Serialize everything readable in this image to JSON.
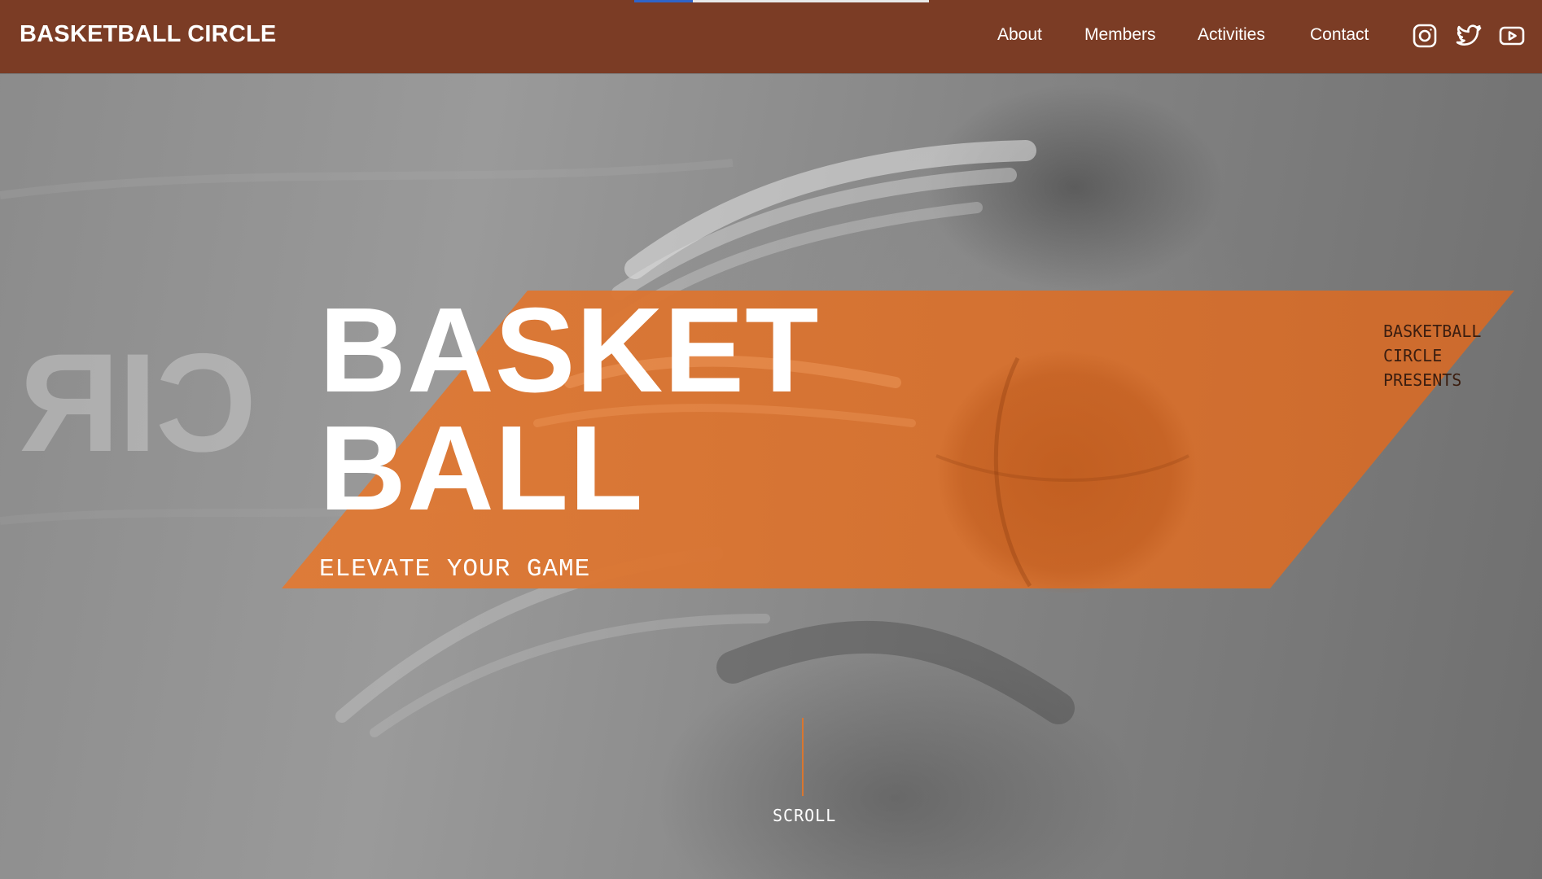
{
  "header": {
    "brand": "BASKETBALL CIRCLE",
    "nav": [
      {
        "label": "About"
      },
      {
        "label": "Members"
      },
      {
        "label": "Activities"
      },
      {
        "label": "Contact"
      }
    ],
    "social_icons": [
      "instagram-icon",
      "twitter-icon",
      "youtube-icon"
    ],
    "progress": 0.2
  },
  "hero": {
    "ghost_text": "CIR",
    "headline_line1": "BASKET",
    "headline_line2": "BALL",
    "tagline": "ELEVATE YOUR GAME",
    "side_note": [
      "BASKETBALL",
      "CIRCLE",
      "PRESENTS"
    ],
    "scroll_label": "SCROLL"
  },
  "colors": {
    "header_bg": "#7b3c25",
    "band_orange": "#d8722f",
    "progress_fill": "#2f64c9",
    "scroll_line": "#d9762f",
    "text_white": "#ffffff"
  }
}
